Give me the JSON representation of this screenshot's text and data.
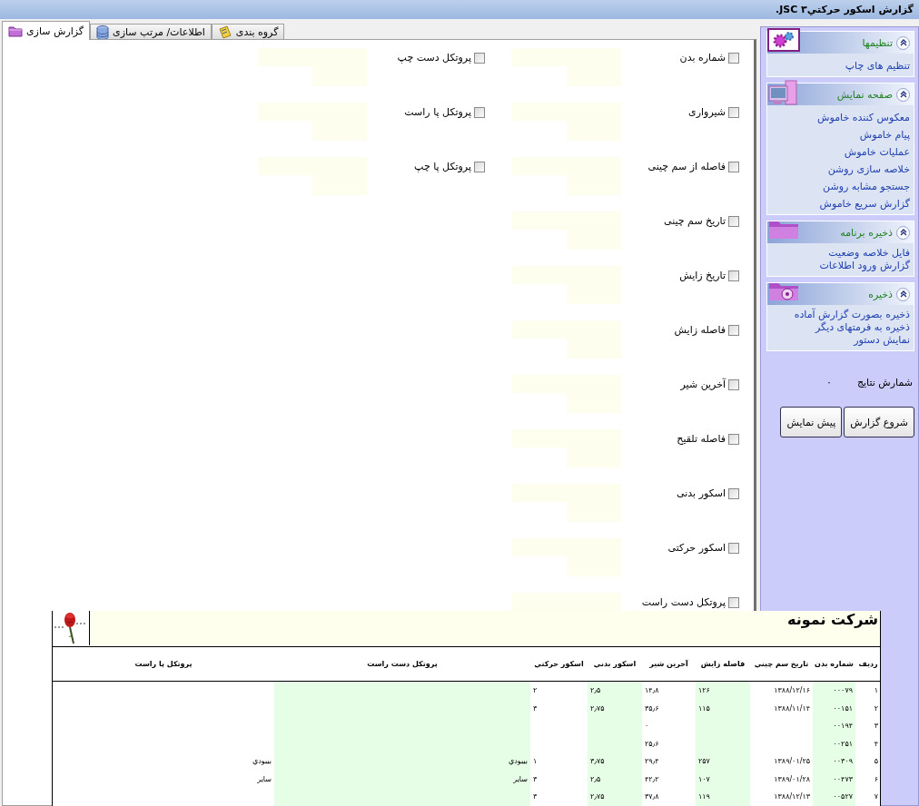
{
  "window": {
    "title": "گزارش اسکور حرکتي۳ JSC."
  },
  "tabs": [
    {
      "label": "گروه بندی",
      "selected": false
    },
    {
      "label": "اطلاعات/ مرتب سازی",
      "selected": false
    },
    {
      "label": "گزارش سازی",
      "selected": true
    }
  ],
  "options_right": [
    {
      "label": "شماره بدن",
      "checked": false
    },
    {
      "label": "شیروارى",
      "checked": false
    },
    {
      "label": "فاصله از سم چینی",
      "checked": false
    },
    {
      "label": "تاریخ سم چینی",
      "checked": false
    },
    {
      "label": "تاریخ زایش",
      "checked": false
    },
    {
      "label": "فاصله زایش",
      "checked": false
    },
    {
      "label": "آخرین شیر",
      "checked": false
    },
    {
      "label": "فاصله تلقیح",
      "checked": false
    },
    {
      "label": "اسکور بدنی",
      "checked": false
    },
    {
      "label": "اسکور حرکتی",
      "checked": false
    },
    {
      "label": "پروتکل دست راست",
      "checked": false
    }
  ],
  "options_left": [
    {
      "label": "پروتکل دست چپ",
      "checked": false
    },
    {
      "label": "پروتکل پا راست",
      "checked": false
    },
    {
      "label": "پروتکل پا چپ",
      "checked": false
    }
  ],
  "sidebar": {
    "groups": [
      {
        "title": "تنظیمها",
        "expanded": true,
        "links": [
          "تنظیم های چاپ"
        ]
      },
      {
        "title": "صفحه نمایش",
        "expanded": true,
        "links": [
          "معکوس کننده خاموش",
          "پیام خاموش",
          "عملیات خاموش",
          "خلاصه سازی روشن",
          "جستجو مشابه روشن",
          "گزارش سریع خاموش"
        ]
      },
      {
        "title": "ذخیره برنامه",
        "expanded": true,
        "links": [
          "فایل خلاصه وضعیت",
          "گزارش ورود اطلاعات"
        ]
      },
      {
        "title": "ذخیره",
        "expanded": true,
        "links": [
          "ذخیره بصورت گزارش آماده",
          "ذخیره به فرمتهای دیگر",
          "نمایش دستور"
        ]
      }
    ],
    "result_count": {
      "label": "شمارش نتایج",
      "value": "۰"
    },
    "buttons": [
      "شروع گزارش",
      "پیش نمایش"
    ]
  },
  "report": {
    "company": "شرکت نمونه",
    "columns": [
      "ردیف",
      "شماره بدن",
      "تاریخ سم چيني",
      "فاصله زايش",
      "آخرين شير",
      "اسکور بدني",
      "اسکور حرکتي",
      "پروتکل دست راست",
      "پروتکل پا راست"
    ],
    "rows": [
      [
        "۱",
        "۰۰۰۷۹",
        "۱۳۸۸/۱۲/۱۶",
        "۱۲۶",
        "۱۴٫۸",
        "۲٫۵",
        "۲",
        "",
        ""
      ],
      [
        "۲",
        "۰۰۱۵۱",
        "۱۳۸۸/۱۱/۱۴",
        "۱۱۵",
        "۳۵٫۶",
        "۲٫۷۵",
        "۳",
        "",
        ""
      ],
      [
        "۳",
        "۰۰۱۹۴",
        "",
        "",
        "۰",
        "",
        "",
        "",
        ""
      ],
      [
        "۴",
        "۰۰۲۵۱",
        "",
        "",
        "۲۵٫۶",
        "",
        "",
        "",
        ""
      ],
      [
        "۵",
        "۰۰۳۰۹",
        "۱۳۸۹/۰۱/۲۵",
        "۲۵۷",
        "۲۹٫۴",
        "۳٫۷۵",
        "۱",
        "بيبودي",
        "بيبودي"
      ],
      [
        "۶",
        "۰۰۴۷۳",
        "۱۳۸۹/۰۱/۲۸",
        "۱۰۷",
        "۴۲٫۲",
        "۲٫۵",
        "۳",
        "ساير",
        "ساير"
      ],
      [
        "۷",
        "۰۰۵۲۷",
        "۱۳۸۸/۱۲/۱۳",
        "۱۱۹",
        "۳۷٫۸",
        "۲٫۷۵",
        "۳",
        "",
        ""
      ]
    ]
  }
}
